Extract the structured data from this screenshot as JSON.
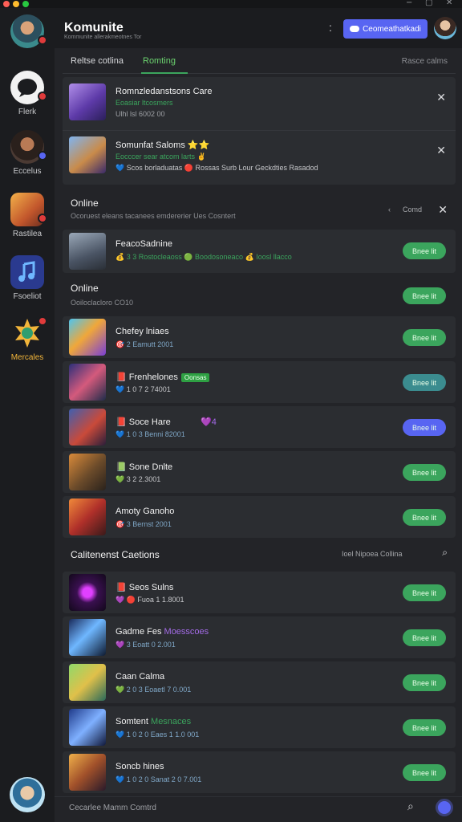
{
  "window": {
    "controls": [
      "−",
      "▢",
      "✕"
    ]
  },
  "colors": {
    "accent": "#5865f2",
    "online": "#3ba55d",
    "background": "#232428",
    "rail": "#1b1c1f"
  },
  "rail": {
    "items": [
      {
        "label": "",
        "icon": "user-avatar-icon"
      },
      {
        "label": "Flerk",
        "icon": "chat-bubble-icon"
      },
      {
        "label": "Eccelus",
        "icon": "friend-avatar-icon"
      },
      {
        "label": "Rastilea",
        "icon": "game-icon"
      },
      {
        "label": "Fsoeliot",
        "icon": "music-note-icon"
      },
      {
        "label": "Mercales",
        "icon": "badge-icon"
      }
    ]
  },
  "header": {
    "title": "Komunite",
    "subtitle": "Kommunite allerakmeotnes Tor",
    "menu_glyph": ":",
    "primary_button": "Ceomeathatkadi"
  },
  "tabs": {
    "items": [
      "Reltse cotlina",
      "Romting"
    ],
    "right": "Rasce calms"
  },
  "requests": [
    {
      "title": "Romnzledanstsons Care",
      "line1": "Eoasiar ltcosmers",
      "line2": "Ulhl lsl 6002 00"
    },
    {
      "title": "Somunfat Saloms ⭐⭐",
      "line1": "Eocccer sear atcom larts ✌",
      "line2": "💙 Scos borladuatas  🔴 Rossas Surb  Lour Geckdties Rasadod"
    }
  ],
  "online_section": {
    "heading": "Online",
    "subtitle": "Ocoruest eleans tacanees emdererier Ues Cosntert",
    "right_label": "Comd",
    "chevron": "‹"
  },
  "featured": {
    "title": "FeacoSadnine",
    "meta": "💰 3 3   Rostocleaoss   🟢 Boodosoneaco   💰 Ioosl llacco",
    "button": "Bnee lit"
  },
  "online2": {
    "heading": "Online",
    "subtitle": "Ooiloclacloro CO10",
    "button": "Bnee lit"
  },
  "games": [
    {
      "title": "Chefey lniaes",
      "meta": "🎯 2   Eamutt 2001",
      "button": "Bnee lit",
      "btn_color": "#3ba55d"
    },
    {
      "title": "📕 Frenhelones",
      "tag": "Oonsas",
      "meta": "💙 1 0 7   2 74001",
      "button": "Bnee lit",
      "btn_color": "#3b8c8f"
    },
    {
      "title": "📕 Soce Hare",
      "extra": "💜4",
      "meta": "💙 1 0 3   Benni 82001",
      "button": "Bnee lit",
      "btn_color": "#5865f2"
    },
    {
      "title": "📗 Sone Dnlte",
      "meta": "💚 3   2 2.3001",
      "button": "Bnee lit",
      "btn_color": "#3ba55d"
    },
    {
      "title": "Amoty Ganoho",
      "meta": "🎯 3   Bernst 2001",
      "button": "Bnee lit",
      "btn_color": "#3ba55d"
    }
  ],
  "section2": {
    "heading": "Calitenenst Caetions",
    "right_label": "Ioel Nipoea Collina"
  },
  "list2": [
    {
      "title": "📕 Seos Sulns",
      "meta": "💜 🔴 Fuoa 1 1.8001",
      "button": "Bnee lit"
    },
    {
      "title": "Gadme Fes",
      "tag": "Moesscoes",
      "meta": "💜 3   Eoatt 0 2.001",
      "button": "Bnee lit"
    },
    {
      "title": "Caan Calma",
      "meta": "💚 2 0 3   Eoaetl 7 0.001",
      "button": "Bnee lit"
    },
    {
      "title": "Somtent",
      "tag": "Mesnaces",
      "meta": "💙 1 0 2 0   Eaes 1 1.0 001",
      "button": "Bnee lit"
    },
    {
      "title": "Soncb hines",
      "meta": "💙 1 0 2 0   Sanat 2 0 7.001",
      "button": "Bnee lit"
    }
  ],
  "footer": {
    "text": "Cecarlee Mamm Comtrd"
  }
}
